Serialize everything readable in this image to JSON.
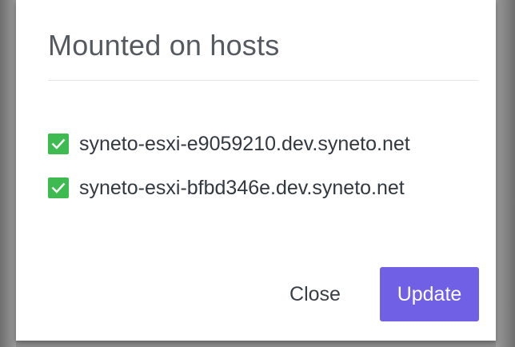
{
  "dialog": {
    "title": "Mounted on hosts",
    "hosts": [
      {
        "name": "syneto-esxi-e9059210.dev.syneto.net",
        "checked": true
      },
      {
        "name": "syneto-esxi-bfbd346e.dev.syneto.net",
        "checked": true
      }
    ],
    "close_label": "Close",
    "update_label": "Update"
  },
  "icons": {
    "checkbox": "checkmark-icon"
  },
  "colors": {
    "accent": "#6f60e6",
    "checkbox": "#3dbb51",
    "title_text": "#555a60",
    "body_text": "#333940"
  }
}
